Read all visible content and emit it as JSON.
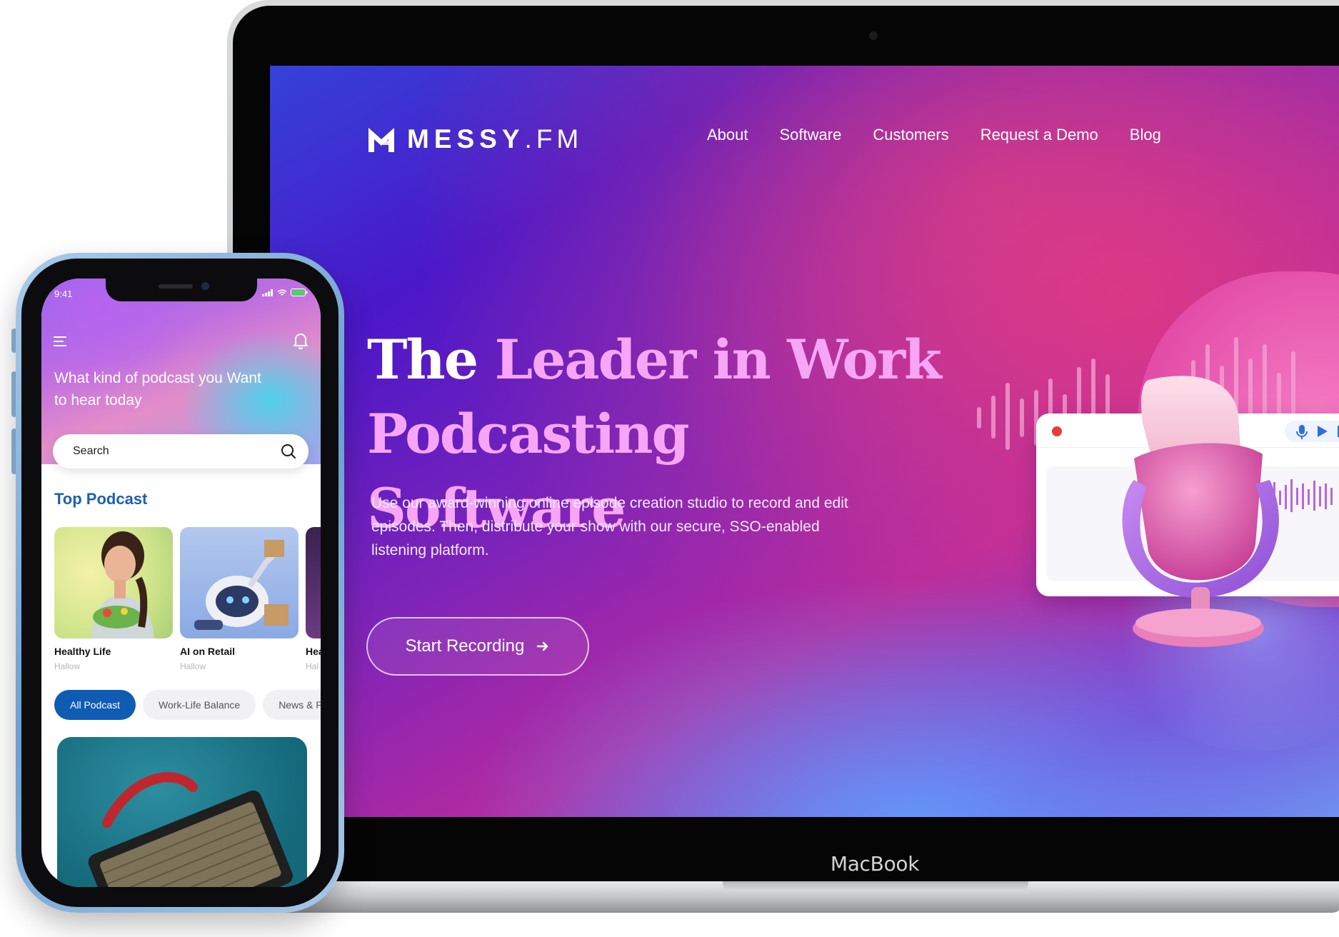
{
  "laptop": {
    "brand_label": "MacBook"
  },
  "website": {
    "logo": {
      "brand": "MESSY",
      "suffix": ".FM"
    },
    "nav": [
      {
        "label": "About"
      },
      {
        "label": "Software"
      },
      {
        "label": "Customers"
      },
      {
        "label": "Request a Demo"
      },
      {
        "label": "Blog"
      }
    ],
    "hero": {
      "title_line1_plain": "The ",
      "title_line1_highlight": "Leader in Work",
      "title_line2": "Podcasting Software",
      "description": "Use our award-winning online episode creation studio to record and edit episodes. Then, distribute your show with our secure, SSO-enabled listening platform.",
      "cta_label": "Start Recording"
    },
    "colors": {
      "highlight": "#f7a6f7",
      "blob": "#e24aa6",
      "record_dot": "#ea3a3a"
    }
  },
  "phone": {
    "status": {
      "time": "9:41"
    },
    "icons": [
      "menu-icon",
      "bell-icon",
      "search-icon",
      "signal-icon",
      "wifi-icon",
      "battery-icon"
    ],
    "headline": "What kind of podcast you Want to hear today",
    "search": {
      "placeholder": "Search"
    },
    "section_title": "Top Podcast",
    "podcasts": [
      {
        "title": "Healthy Life",
        "author": "Hallow"
      },
      {
        "title": "AI on Retail",
        "author": "Hallow"
      },
      {
        "title": "Hea",
        "author": "Hal"
      }
    ],
    "chips": [
      {
        "label": "All Podcast",
        "active": true
      },
      {
        "label": "Work-Life Balance",
        "active": false
      },
      {
        "label": "News & Po",
        "active": false
      }
    ],
    "colors": {
      "accent": "#0f5cb3",
      "section_title": "#1c5fb4"
    }
  }
}
